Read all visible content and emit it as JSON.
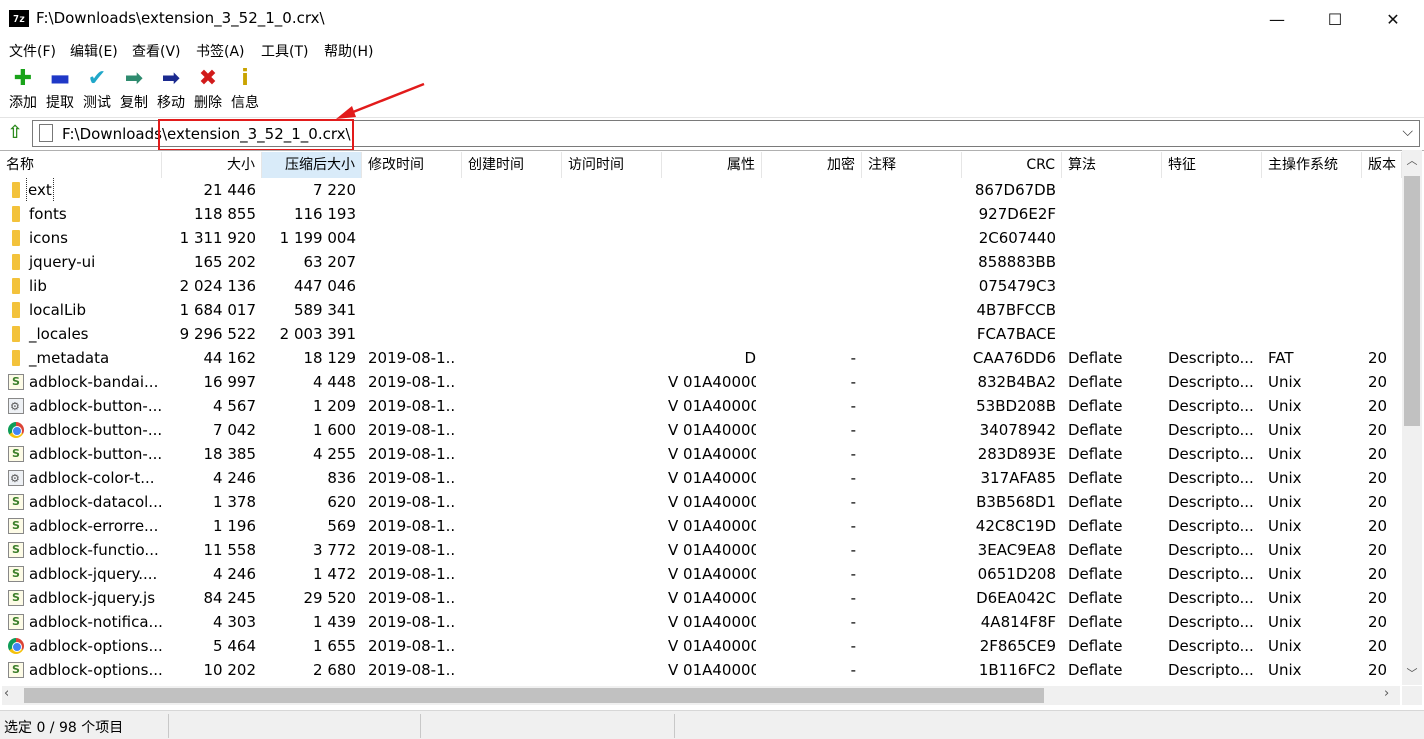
{
  "window": {
    "app_icon_label": "7z",
    "title": "F:\\Downloads\\extension_3_52_1_0.crx\\",
    "controls": {
      "minimize": "—",
      "maximize": "☐",
      "close": "✕"
    }
  },
  "menu": [
    "文件(F)",
    "编辑(E)",
    "查看(V)",
    "书签(A)",
    "工具(T)",
    "帮助(H)"
  ],
  "toolbar": [
    {
      "label": "添加",
      "icon": "add-icon",
      "glyph": "✚",
      "color": "#1aa31a"
    },
    {
      "label": "提取",
      "icon": "extract-icon",
      "glyph": "▬",
      "color": "#1f38c7"
    },
    {
      "label": "测试",
      "icon": "test-icon",
      "glyph": "✔",
      "color": "#20a7c9"
    },
    {
      "label": "复制",
      "icon": "copy-icon",
      "glyph": "➡",
      "color": "#2f8b6f"
    },
    {
      "label": "移动",
      "icon": "move-icon",
      "glyph": "➡",
      "color": "#1b2a8f"
    },
    {
      "label": "删除",
      "icon": "delete-icon",
      "glyph": "✖",
      "color": "#d11a1a"
    },
    {
      "label": "信息",
      "icon": "info-icon",
      "glyph": "i",
      "color": "#c9a300"
    }
  ],
  "address": {
    "path": "F:\\Downloads\\extension_3_52_1_0.crx\\",
    "dropdown": "⌵"
  },
  "columns": [
    "名称",
    "大小",
    "压缩后大小",
    "修改时间",
    "创建时间",
    "访问时间",
    "属性",
    "加密",
    "注释",
    "CRC",
    "算法",
    "特征",
    "主操作系统",
    "版本"
  ],
  "sorted_column": "压缩后大小",
  "rows": [
    {
      "icon": "folder",
      "name": "ext",
      "size": "21 446",
      "packed": "7 220",
      "mtime": "",
      "attr": "",
      "enc": "",
      "crc": "867D67DB",
      "method": "",
      "char": "",
      "os": "",
      "ver": ""
    },
    {
      "icon": "folder",
      "name": "fonts",
      "size": "118 855",
      "packed": "116 193",
      "mtime": "",
      "attr": "",
      "enc": "",
      "crc": "927D6E2F",
      "method": "",
      "char": "",
      "os": "",
      "ver": ""
    },
    {
      "icon": "folder",
      "name": "icons",
      "size": "1 311 920",
      "packed": "1 199 004",
      "mtime": "",
      "attr": "",
      "enc": "",
      "crc": "2C607440",
      "method": "",
      "char": "",
      "os": "",
      "ver": ""
    },
    {
      "icon": "folder",
      "name": "jquery-ui",
      "size": "165 202",
      "packed": "63 207",
      "mtime": "",
      "attr": "",
      "enc": "",
      "crc": "858883BB",
      "method": "",
      "char": "",
      "os": "",
      "ver": ""
    },
    {
      "icon": "folder",
      "name": "lib",
      "size": "2 024 136",
      "packed": "447 046",
      "mtime": "",
      "attr": "",
      "enc": "",
      "crc": "075479C3",
      "method": "",
      "char": "",
      "os": "",
      "ver": ""
    },
    {
      "icon": "folder",
      "name": "localLib",
      "size": "1 684 017",
      "packed": "589 341",
      "mtime": "",
      "attr": "",
      "enc": "",
      "crc": "4B7BFCCB",
      "method": "",
      "char": "",
      "os": "",
      "ver": ""
    },
    {
      "icon": "folder",
      "name": "_locales",
      "size": "9 296 522",
      "packed": "2 003 391",
      "mtime": "",
      "attr": "",
      "enc": "",
      "crc": "FCA7BACE",
      "method": "",
      "char": "",
      "os": "",
      "ver": ""
    },
    {
      "icon": "folder",
      "name": "_metadata",
      "size": "44 162",
      "packed": "18 129",
      "mtime": "2019-08-1...",
      "attr": "D",
      "enc": "-",
      "crc": "CAA76DD6",
      "method": "Deflate",
      "char": "Descripto...",
      "os": "FAT",
      "ver": "20"
    },
    {
      "icon": "js",
      "name": "adblock-bandai...",
      "size": "16 997",
      "packed": "4 448",
      "mtime": "2019-08-1...",
      "attr": "V 01A40000",
      "enc": "-",
      "crc": "832B4BA2",
      "method": "Deflate",
      "char": "Descripto...",
      "os": "Unix",
      "ver": "20"
    },
    {
      "icon": "img",
      "name": "adblock-button-...",
      "size": "4 567",
      "packed": "1 209",
      "mtime": "2019-08-1...",
      "attr": "V 01A40000",
      "enc": "-",
      "crc": "53BD208B",
      "method": "Deflate",
      "char": "Descripto...",
      "os": "Unix",
      "ver": "20"
    },
    {
      "icon": "chrome",
      "name": "adblock-button-...",
      "size": "7 042",
      "packed": "1 600",
      "mtime": "2019-08-1...",
      "attr": "V 01A40000",
      "enc": "-",
      "crc": "34078942",
      "method": "Deflate",
      "char": "Descripto...",
      "os": "Unix",
      "ver": "20"
    },
    {
      "icon": "js",
      "name": "adblock-button-...",
      "size": "18 385",
      "packed": "4 255",
      "mtime": "2019-08-1...",
      "attr": "V 01A40000",
      "enc": "-",
      "crc": "283D893E",
      "method": "Deflate",
      "char": "Descripto...",
      "os": "Unix",
      "ver": "20"
    },
    {
      "icon": "img",
      "name": "adblock-color-t...",
      "size": "4 246",
      "packed": "836",
      "mtime": "2019-08-1...",
      "attr": "V 01A40000",
      "enc": "-",
      "crc": "317AFA85",
      "method": "Deflate",
      "char": "Descripto...",
      "os": "Unix",
      "ver": "20"
    },
    {
      "icon": "js",
      "name": "adblock-datacol...",
      "size": "1 378",
      "packed": "620",
      "mtime": "2019-08-1...",
      "attr": "V 01A40000",
      "enc": "-",
      "crc": "B3B568D1",
      "method": "Deflate",
      "char": "Descripto...",
      "os": "Unix",
      "ver": "20"
    },
    {
      "icon": "js",
      "name": "adblock-errorre...",
      "size": "1 196",
      "packed": "569",
      "mtime": "2019-08-1...",
      "attr": "V 01A40000",
      "enc": "-",
      "crc": "42C8C19D",
      "method": "Deflate",
      "char": "Descripto...",
      "os": "Unix",
      "ver": "20"
    },
    {
      "icon": "js",
      "name": "adblock-functio...",
      "size": "11 558",
      "packed": "3 772",
      "mtime": "2019-08-1...",
      "attr": "V 01A40000",
      "enc": "-",
      "crc": "3EAC9EA8",
      "method": "Deflate",
      "char": "Descripto...",
      "os": "Unix",
      "ver": "20"
    },
    {
      "icon": "js",
      "name": "adblock-jquery....",
      "size": "4 246",
      "packed": "1 472",
      "mtime": "2019-08-1...",
      "attr": "V 01A40000",
      "enc": "-",
      "crc": "0651D208",
      "method": "Deflate",
      "char": "Descripto...",
      "os": "Unix",
      "ver": "20"
    },
    {
      "icon": "js",
      "name": "adblock-jquery.js",
      "size": "84 245",
      "packed": "29 520",
      "mtime": "2019-08-1...",
      "attr": "V 01A40000",
      "enc": "-",
      "crc": "D6EA042C",
      "method": "Deflate",
      "char": "Descripto...",
      "os": "Unix",
      "ver": "20"
    },
    {
      "icon": "js",
      "name": "adblock-notifica...",
      "size": "4 303",
      "packed": "1 439",
      "mtime": "2019-08-1...",
      "attr": "V 01A40000",
      "enc": "-",
      "crc": "4A814F8F",
      "method": "Deflate",
      "char": "Descripto...",
      "os": "Unix",
      "ver": "20"
    },
    {
      "icon": "chrome",
      "name": "adblock-options...",
      "size": "5 464",
      "packed": "1 655",
      "mtime": "2019-08-1...",
      "attr": "V 01A40000",
      "enc": "-",
      "crc": "2F865CE9",
      "method": "Deflate",
      "char": "Descripto...",
      "os": "Unix",
      "ver": "20"
    },
    {
      "icon": "js",
      "name": "adblock-options...",
      "size": "10 202",
      "packed": "2 680",
      "mtime": "2019-08-1...",
      "attr": "V 01A40000",
      "enc": "-",
      "crc": "1B116FC2",
      "method": "Deflate",
      "char": "Descripto...",
      "os": "Unix",
      "ver": "20"
    }
  ],
  "status": {
    "text": "选定 0 / 98 个项目"
  },
  "scroll": {
    "vertical_up": "︿",
    "vertical_down": "﹀",
    "horizontal_left": "‹",
    "horizontal_right": "›"
  },
  "annotation": {
    "box_color": "#e21b1b"
  }
}
